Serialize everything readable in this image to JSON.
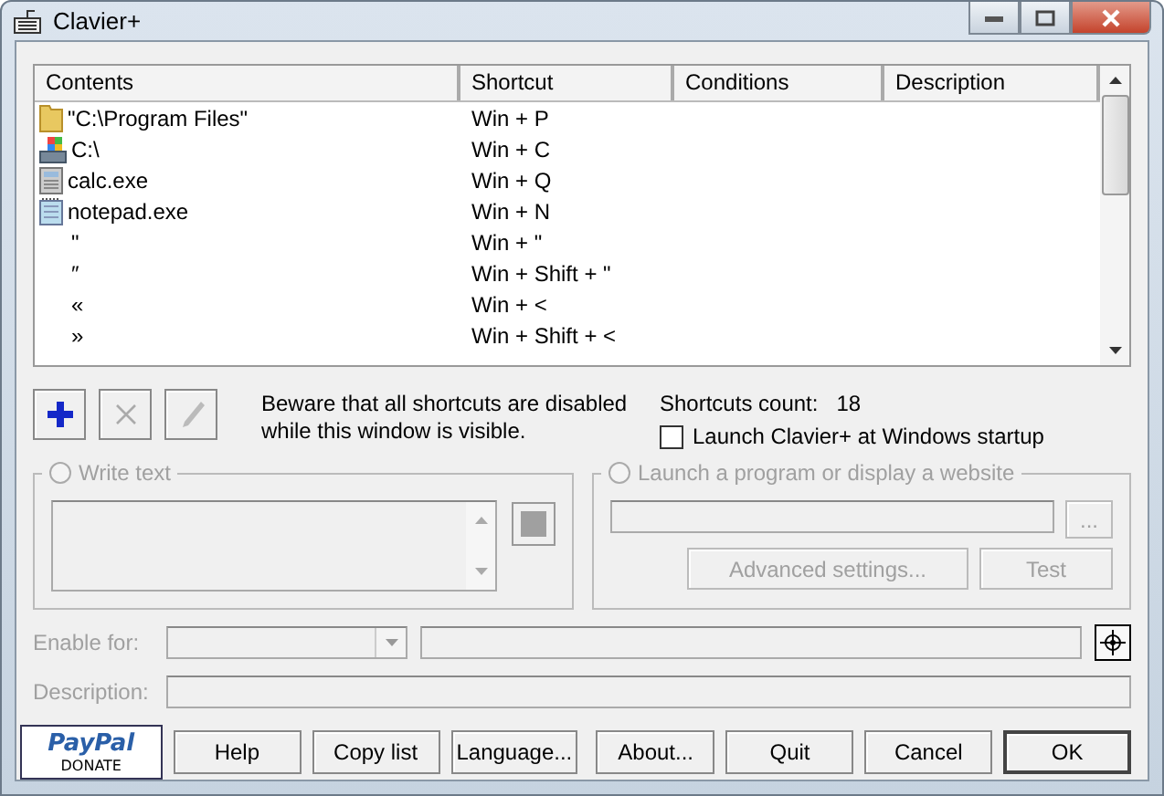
{
  "window": {
    "title": "Clavier+"
  },
  "list": {
    "columns": [
      "Contents",
      "Shortcut",
      "Conditions",
      "Description"
    ],
    "rows": [
      {
        "kind": "folder",
        "contents": "\"C:\\Program Files\"",
        "shortcut": "Win + P"
      },
      {
        "kind": "drive",
        "contents": "C:\\",
        "shortcut": "Win + C"
      },
      {
        "kind": "calculator",
        "contents": "calc.exe",
        "shortcut": "Win + Q"
      },
      {
        "kind": "notepad",
        "contents": "notepad.exe",
        "shortcut": "Win + N"
      },
      {
        "kind": "text",
        "contents": "\"",
        "shortcut": "Win + \""
      },
      {
        "kind": "text",
        "contents": "″",
        "shortcut": "Win + Shift + \""
      },
      {
        "kind": "text",
        "contents": "«",
        "shortcut": "Win + <"
      },
      {
        "kind": "text",
        "contents": "»",
        "shortcut": "Win + Shift + <"
      }
    ]
  },
  "toolbar": [
    {
      "kind": "add",
      "disabled": false
    },
    {
      "kind": "delete",
      "disabled": true
    },
    {
      "kind": "edit",
      "disabled": true
    }
  ],
  "notice": "Beware that all shortcuts are disabled while this window is visible.",
  "shortcuts_count": {
    "label": "Shortcuts count:",
    "value": "18"
  },
  "startup": {
    "label": "Launch Clavier+ at Windows startup",
    "checked": false
  },
  "write_text": {
    "label": "Write text",
    "selected": false,
    "disabled": true
  },
  "launch": {
    "label": "Launch a program or display a website",
    "selected": false,
    "disabled": true,
    "browse": "...",
    "advanced": "Advanced settings...",
    "test": "Test"
  },
  "enable_for": {
    "label": "Enable for:",
    "disabled": true
  },
  "description": {
    "label": "Description:",
    "disabled": true
  },
  "donate": {
    "logo": "PayPal",
    "label": "DONATE"
  },
  "buttons": [
    "Help",
    "Copy list",
    "Language...",
    "About...",
    "Quit",
    "Cancel",
    "OK"
  ]
}
